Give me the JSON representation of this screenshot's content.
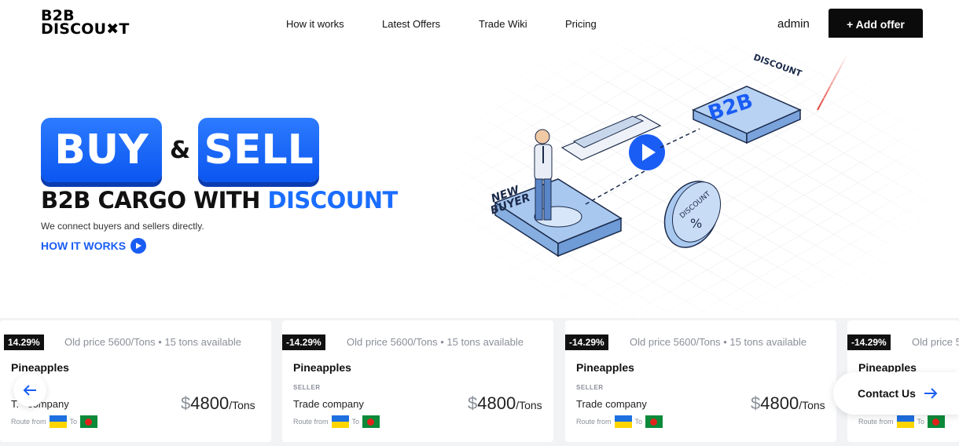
{
  "header": {
    "logo_line1": "B2B",
    "logo_line2": "DISCOU✖T",
    "nav": [
      {
        "label": "How it works"
      },
      {
        "label": "Latest Offers"
      },
      {
        "label": "Trade Wiki"
      },
      {
        "label": "Pricing"
      }
    ],
    "user": "admin",
    "add_offer_label": "+ Add offer"
  },
  "hero": {
    "buy": "BUY",
    "amp": "&",
    "sell": "SELL",
    "headline_main": "B2B CARGO WITH ",
    "headline_accent": "DISCOUNT",
    "subtext": "We connect buyers and sellers directly.",
    "cta": "HOW IT WORKS",
    "illustration": {
      "new_buyer": "NEW BUYER",
      "b2b_label": "B2B",
      "discount_label": "DISCOUNT",
      "coin_label": "DISCOUNT",
      "coin_symbol": "%"
    }
  },
  "offers": [
    {
      "discount": "14.29%",
      "old": "Old price 5600/Tons • 15 tons available",
      "product": "Pineapples",
      "role": "",
      "company": "company",
      "company_prefix": "T.",
      "price_symbol": "$",
      "price": "4800",
      "unit": "/Tons",
      "route_from": "Route from",
      "route_to": "To"
    },
    {
      "discount": "-14.29%",
      "old": "Old price 5600/Tons • 15 tons available",
      "product": "Pineapples",
      "role": "SELLER",
      "company": "Trade company",
      "price_symbol": "$",
      "price": "4800",
      "unit": "/Tons",
      "route_from": "Route from",
      "route_to": "To"
    },
    {
      "discount": "-14.29%",
      "old": "Old price 5600/Tons • 15 tons available",
      "product": "Pineapples",
      "role": "SELLER",
      "company": "Trade company",
      "price_symbol": "$",
      "price": "4800",
      "unit": "/Tons",
      "route_from": "Route from",
      "route_to": "To"
    },
    {
      "discount": "-14.29%",
      "old": "Old price 5",
      "product": "Pineapples",
      "role": "",
      "company": "",
      "route_from": "Route from",
      "route_to": "To"
    }
  ],
  "contact_label": "Contact Us",
  "colors": {
    "accent": "#1a6dff",
    "dark": "#0b0b0b",
    "annotation": "#e0231b"
  }
}
